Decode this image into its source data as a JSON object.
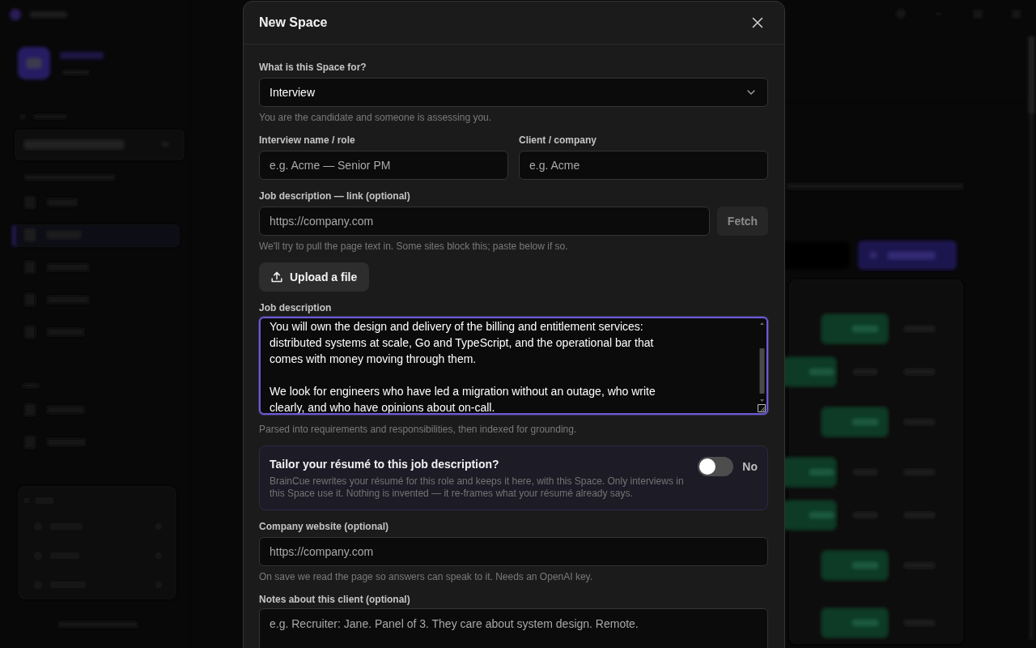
{
  "dialog": {
    "title": "New Space"
  },
  "fields": [
    {
      "kind": "select",
      "label": "What is this Space for?",
      "value": "Interview",
      "help": "You are the candidate and someone is assessing you."
    },
    {
      "kind": "pair",
      "items": [
        {
          "label": "Interview name / role",
          "placeholder": "e.g. Acme — Senior PM"
        },
        {
          "label": "Client / company",
          "placeholder": "e.g. Acme"
        }
      ]
    },
    {
      "kind": "fetch",
      "label": "Job description — link (optional)",
      "placeholder": "https://company.com",
      "button": {
        "label": "Fetch",
        "disabled": true
      },
      "help": "We'll try to pull the page text in. Some sites block this; paste below if so."
    },
    {
      "kind": "upload",
      "button": {
        "label": "Upload a file"
      }
    },
    {
      "kind": "textarea",
      "label": "Job description",
      "value": "You will own the design and delivery of the billing and entitlement services:\ndistributed systems at scale, Go and TypeScript, and the operational bar that\ncomes with money moving through them.\n\nWe look for engineers who have led a migration without an outage, who write\nclearly, and who have opinions about on-call.",
      "focused": true,
      "scrolled": true,
      "help": "Parsed into requirements and responsibilities, then indexed for grounding."
    },
    {
      "kind": "toggle",
      "title": "Tailor your résumé to this job description?",
      "description": "BrainCue rewrites your résumé for this role and keeps it here, with this Space. Only interviews in this Space use it. Nothing is invented — it re-frames what your résumé already says.",
      "on": false,
      "state_label": "No"
    },
    {
      "kind": "input",
      "label": "Company website (optional)",
      "placeholder": "https://company.com",
      "help": "On save we read the page so answers can speak to it. Needs an OpenAI key."
    },
    {
      "kind": "textarea",
      "label": "Notes about this client (optional)",
      "placeholder": "e.g. Recruiter: Jane. Panel of 3. They care about system design. Remote.",
      "focused": false
    }
  ]
}
